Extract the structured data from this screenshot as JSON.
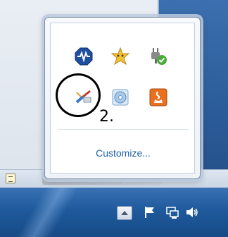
{
  "notification_area_popup": {
    "icons": [
      {
        "name": "network-monitor-icon",
        "color": "#1f4fa0"
      },
      {
        "name": "star-emblem-icon",
        "color": "#e9b328"
      },
      {
        "name": "power-plug-check-icon",
        "color": "#4caa3c"
      },
      {
        "name": "usb-safely-remove-icon",
        "color": "#3b79c6"
      },
      {
        "name": "disc-drive-icon",
        "color": "#8fb7dc"
      },
      {
        "name": "java-update-icon",
        "color": "#e8701f"
      }
    ],
    "customize_label": "Customize..."
  },
  "annotation": {
    "step_label": "2."
  },
  "taskbar": {
    "tray_icons": [
      "show-hidden-icons-button",
      "action-center-flag-icon",
      "network-icon",
      "volume-icon"
    ]
  },
  "colors": {
    "link": "#1e5fa8",
    "taskbar": "#1f5a9c"
  }
}
